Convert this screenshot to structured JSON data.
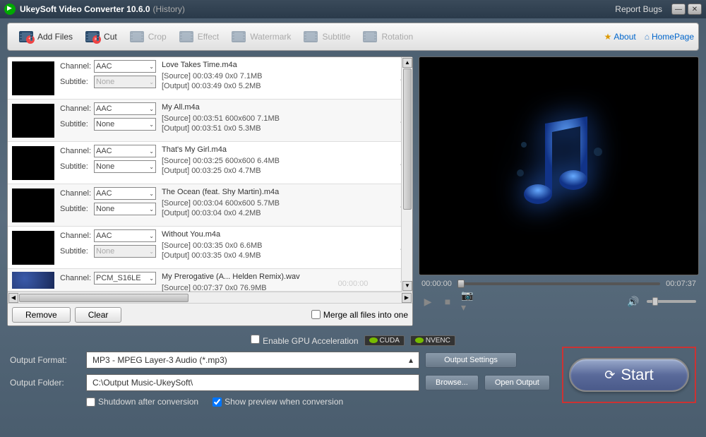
{
  "titlebar": {
    "app_name": "UkeySoft Video Converter 10.6.0",
    "history": "(History)",
    "report_bugs": "Report Bugs"
  },
  "toolbar": {
    "add_files": "Add Files",
    "cut": "Cut",
    "crop": "Crop",
    "effect": "Effect",
    "watermark": "Watermark",
    "subtitle": "Subtitle",
    "rotation": "Rotation",
    "about": "About",
    "homepage": "HomePage"
  },
  "filelist": {
    "channel_label": "Channel:",
    "subtitle_label": "Subtitle:",
    "items": [
      {
        "channel": "AAC",
        "subtitle": "None",
        "subtitle_disabled": true,
        "name": "Love Takes Time.m4a",
        "source": "[Source]  00:03:49  0x0          7.1MB",
        "output": "[Output]  00:03:49  0x0          5.2MB"
      },
      {
        "channel": "AAC",
        "subtitle": "None",
        "subtitle_disabled": false,
        "name": "My All.m4a",
        "source": "[Source]  00:03:51  600x600  7.1MB",
        "output": "[Output]  00:03:51  0x0  5.3MB"
      },
      {
        "channel": "AAC",
        "subtitle": "None",
        "subtitle_disabled": false,
        "name": "That's My Girl.m4a",
        "source": "[Source]  00:03:25  600x600  6.4MB",
        "output": "[Output]  00:03:25  0x0  4.7MB"
      },
      {
        "channel": "AAC",
        "subtitle": "None",
        "subtitle_disabled": false,
        "name": "The Ocean (feat. Shy Martin).m4a",
        "source": "[Source]  00:03:04  600x600  5.7MB",
        "output": "[Output]  00:03:04  0x0  4.2MB"
      },
      {
        "channel": "AAC",
        "subtitle": "None",
        "subtitle_disabled": true,
        "name": "Without You.m4a",
        "source": "[Source]  00:03:35  0x0          6.6MB",
        "output": "[Output]  00:03:35  0x0          4.9MB"
      }
    ],
    "last_item": {
      "channel": "PCM_S16LE",
      "name": "My Prerogative (A... Helden Remix).wav",
      "source": "[Source]  00:07:37  0x0          76.9MB"
    },
    "remove": "Remove",
    "clear": "Clear",
    "merge": "Merge all files into one"
  },
  "preview": {
    "time_start": "00:00:00",
    "time_mid": "00:00:00",
    "time_end": "00:07:37"
  },
  "bottom": {
    "gpu_label": "Enable GPU Acceleration",
    "cuda": "CUDA",
    "nvenc": "NVENC",
    "output_format_label": "Output Format:",
    "output_format_value": "MP3 - MPEG Layer-3 Audio (*.mp3)",
    "output_settings": "Output Settings",
    "output_folder_label": "Output Folder:",
    "output_folder_value": "C:\\Output Music-UkeySoft\\",
    "browse": "Browse...",
    "open_output": "Open Output",
    "shutdown": "Shutdown after conversion",
    "show_preview": "Show preview when conversion",
    "start": "Start"
  }
}
